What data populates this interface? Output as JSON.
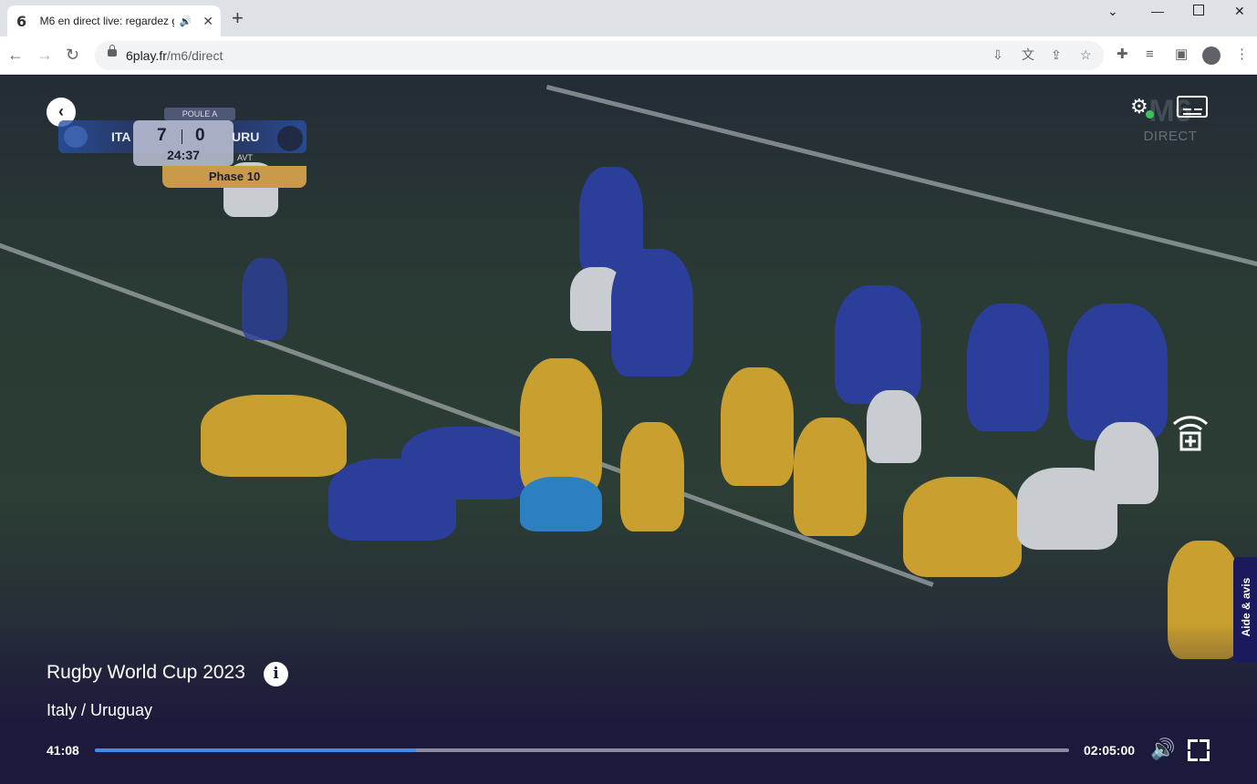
{
  "browser": {
    "tab_title": "M6 en direct live: regardez g",
    "tab_favicon": "6",
    "url_host": "6play.fr",
    "url_path": "/m6/direct"
  },
  "scoreboard": {
    "pool": "POULE A",
    "team_left": "ITA",
    "team_right": "URU",
    "score_left": "7",
    "score_right": "0",
    "clock": "24:37",
    "period": "AVT",
    "phase": "Phase 10"
  },
  "channel_logo": {
    "mark": "M6",
    "label": "DIRECT"
  },
  "side_tab": "Aide & avis",
  "program": {
    "title": "Rugby World Cup 2023",
    "subtitle": "Italy / Uruguay"
  },
  "player": {
    "current_time": "41:08",
    "total_time": "02:05:00",
    "progress": 0.33
  },
  "colors": {
    "progress_fill": "#3f8cf0",
    "background": "#1c1a3c",
    "side_tab": "#1b1a5c"
  }
}
